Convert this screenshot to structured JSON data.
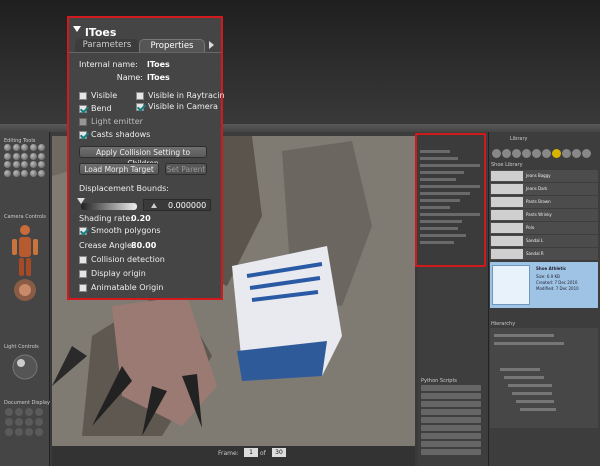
{
  "panel": {
    "title": "lToes",
    "tabs": [
      {
        "label": "Parameters"
      },
      {
        "label": "Properties"
      }
    ],
    "internal_name_label": "Internal name:",
    "internal_name_value": "lToes",
    "name_label": "Name:",
    "name_value": "lToes",
    "checkboxes": {
      "visible": {
        "label": "Visible",
        "checked": false
      },
      "visible_raytracing": {
        "label": "Visible in Raytracin",
        "checked": false
      },
      "bend": {
        "label": "Bend",
        "checked": true
      },
      "visible_camera": {
        "label": "Visible in Camera",
        "checked": true
      },
      "light_emitter": {
        "label": "Light emitter",
        "checked": false
      },
      "casts_shadows": {
        "label": "Casts shadows",
        "checked": true
      },
      "smooth_polygons": {
        "label": "Smooth polygons",
        "checked": true
      },
      "collision_detection": {
        "label": "Collision detection",
        "checked": false
      },
      "display_origin": {
        "label": "Display origin",
        "checked": false
      },
      "animatable_origin": {
        "label": "Animatable Origin",
        "checked": false
      }
    },
    "apply_collision_button": "Apply Collision Setting to Children",
    "load_morph_button": "Load Morph Target",
    "set_parent_button": "Set Parent",
    "displacement_label": "Displacement Bounds:",
    "displacement_value": "0.000000",
    "shading_rate_label": "Shading rate:",
    "shading_rate_value": "0.20",
    "crease_angle_label": "Crease Angle",
    "crease_angle_value": "80.00"
  },
  "app": {
    "left_labels": {
      "editing_tools": "Editing Tools",
      "camera_controls": "Camera Controls",
      "light_controls": "Light Controls",
      "document_display": "Document Display"
    },
    "frame_label": "Frame:",
    "frame_value": "1",
    "frame_of": "of",
    "frame_total": "30",
    "library": {
      "title": "Library",
      "header": "Shoe Library",
      "items": [
        "Jeans Baggy",
        "Jeans Dark",
        "Pants Brown",
        "Pants Wrinky",
        "Polo",
        "Sandal L",
        "Sandal R",
        "Shirt Long Sleeve"
      ],
      "selected": "Shoe Athletic",
      "selected_details": [
        "Size: 6.9 KB",
        "Created: 7 Dec 2010",
        "Modified: 7 Dec 2010"
      ]
    },
    "hierarchy_label": "Hierarchy",
    "python_label": "Python Scripts"
  },
  "colors": {
    "highlight": "#d2191e",
    "panel_bg": "#454545",
    "library_selected": "#9fc3e4"
  }
}
